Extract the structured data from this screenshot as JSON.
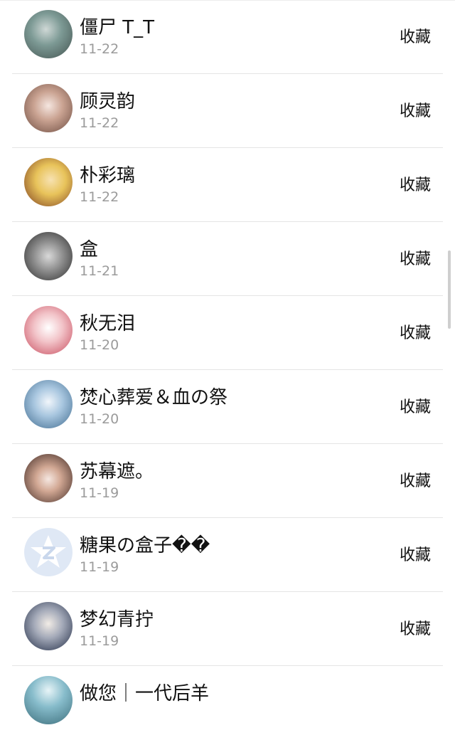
{
  "list": {
    "items": [
      {
        "name": "僵尸 T_T",
        "time": "11-22",
        "action": "收藏",
        "avatar_color": "#6d8f8a",
        "avatar_icon": "avatar-photo"
      },
      {
        "name": "顾灵韵",
        "time": "11-22",
        "action": "收藏",
        "avatar_color": "#b07a6a",
        "avatar_icon": "avatar-photo"
      },
      {
        "name": "朴彩璃",
        "time": "11-22",
        "action": "收藏",
        "avatar_color": "#d9a53a",
        "avatar_icon": "avatar-photo"
      },
      {
        "name": "盒",
        "time": "11-21",
        "action": "收藏",
        "avatar_color": "#5a5a5a",
        "avatar_icon": "avatar-photo"
      },
      {
        "name": "秋无泪",
        "time": "11-20",
        "action": "收藏",
        "avatar_color": "#e87a8a",
        "avatar_icon": "avatar-photo"
      },
      {
        "name": "焚心葬爱＆血の祭",
        "time": "11-20",
        "action": "收藏",
        "avatar_color": "#7fa7c9",
        "avatar_icon": "avatar-photo"
      },
      {
        "name": "苏幕遮。",
        "time": "11-19",
        "action": "收藏",
        "avatar_color": "#6b4a3a",
        "avatar_icon": "avatar-photo"
      },
      {
        "name": "糖果の盒子��",
        "time": "11-19",
        "action": "收藏",
        "avatar_color": "#d7e2f1",
        "avatar_icon": "qq-default-avatar"
      },
      {
        "name": "梦幻青拧",
        "time": "11-19",
        "action": "收藏",
        "avatar_color": "#2f3f63",
        "avatar_icon": "avatar-photo"
      },
      {
        "name": "做您｜一代后羊",
        "time": "",
        "action": "",
        "avatar_color": "#7fb6c6",
        "avatar_icon": "avatar-photo"
      }
    ]
  }
}
